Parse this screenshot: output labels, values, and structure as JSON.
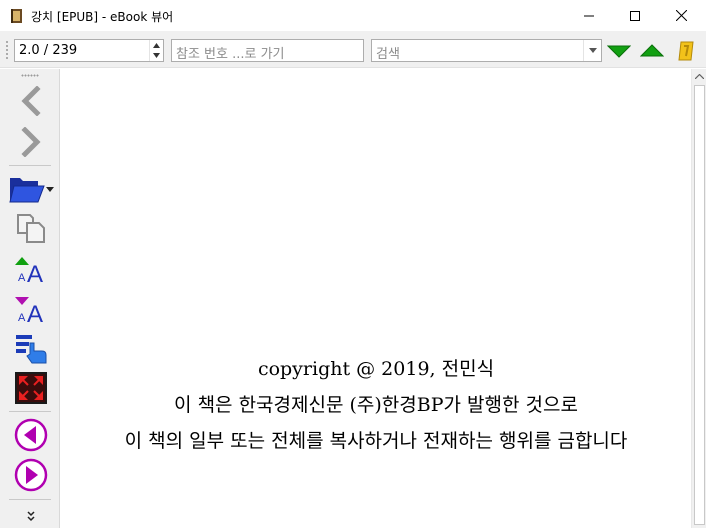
{
  "window": {
    "title": "강치 [EPUB] - eBook 뷰어"
  },
  "toolbar": {
    "page_value": "2.0 / 239",
    "goto_placeholder": "참조 번호 ...로 가기",
    "search_placeholder": "검색"
  },
  "sidebar": {
    "items": [
      {
        "icon": "back-arrow-icon"
      },
      {
        "icon": "forward-arrow-icon"
      },
      {
        "icon": "open-folder-icon"
      },
      {
        "icon": "copy-icon"
      },
      {
        "icon": "font-larger-icon"
      },
      {
        "icon": "font-smaller-icon"
      },
      {
        "icon": "select-text-icon"
      },
      {
        "icon": "fullscreen-icon"
      },
      {
        "icon": "previous-page-icon"
      },
      {
        "icon": "next-page-icon"
      },
      {
        "icon": "more-icon"
      }
    ]
  },
  "page": {
    "lines": [
      "copyright @ 2019, 전민식",
      "이 책은 한국경제신문 (주)한경BP가 발행한 것으로",
      "이 책의 일부 또는 전체를 복사하거나 전재하는 행위를 금합니다"
    ]
  },
  "colors": {
    "nav_green": "#00a000",
    "icon_purple": "#b000b0",
    "icon_blue": "#1c3cb8"
  }
}
